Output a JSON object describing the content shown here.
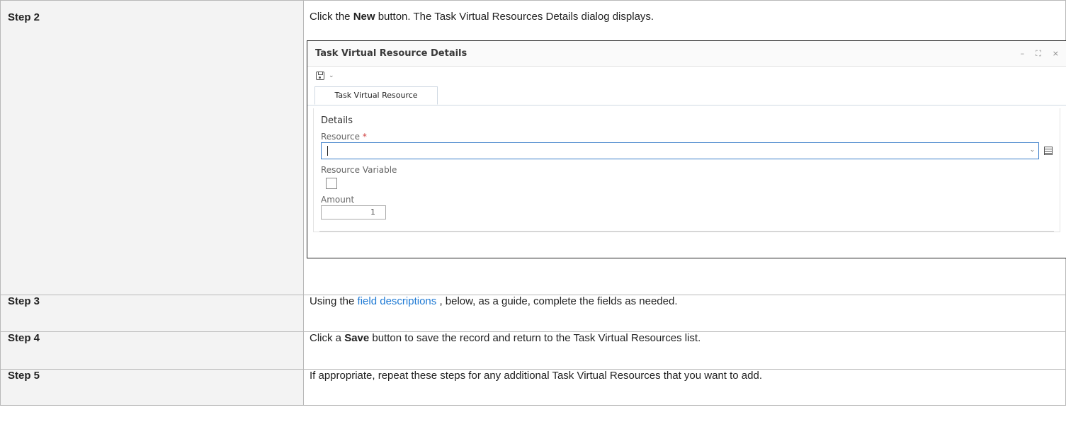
{
  "steps": [
    {
      "label": "Step 2",
      "text_before": "Click the ",
      "bold": "New",
      "text_after": " button. The Task Virtual Resources Details dialog displays."
    },
    {
      "label": "Step 3",
      "text_before": "Using the ",
      "link": "field descriptions",
      "text_after": " , below, as a guide, complete the fields as needed."
    },
    {
      "label": "Step 4",
      "text_before": "Click a ",
      "bold": "Save",
      "text_after": " button to save the record and return to the Task Virtual Resources list."
    },
    {
      "label": "Step 5",
      "text": "If appropriate, repeat these steps for any additional Task Virtual Resources that you want to add."
    }
  ],
  "dialog": {
    "title": "Task Virtual Resource Details",
    "window_controls": [
      "–",
      "⛶",
      "×"
    ],
    "tab_label": "Task Virtual Resource",
    "section_title": "Details",
    "resource_label": "Resource",
    "required_marker": "*",
    "resource_value": "",
    "resource_variable_label": "Resource Variable",
    "resource_variable_checked": false,
    "amount_label": "Amount",
    "amount_value": "1"
  },
  "icons": {
    "save": "save-icon",
    "toolbar_dropdown": "chevron-down-icon",
    "resource_dropdown": "chevron-down-icon",
    "lookup": "list-icon"
  },
  "colors": {
    "link": "#1f7ad4",
    "label_cell_bg": "#f3f3f3",
    "input_focus_border": "#3a7dc9",
    "required": "#d04040"
  }
}
